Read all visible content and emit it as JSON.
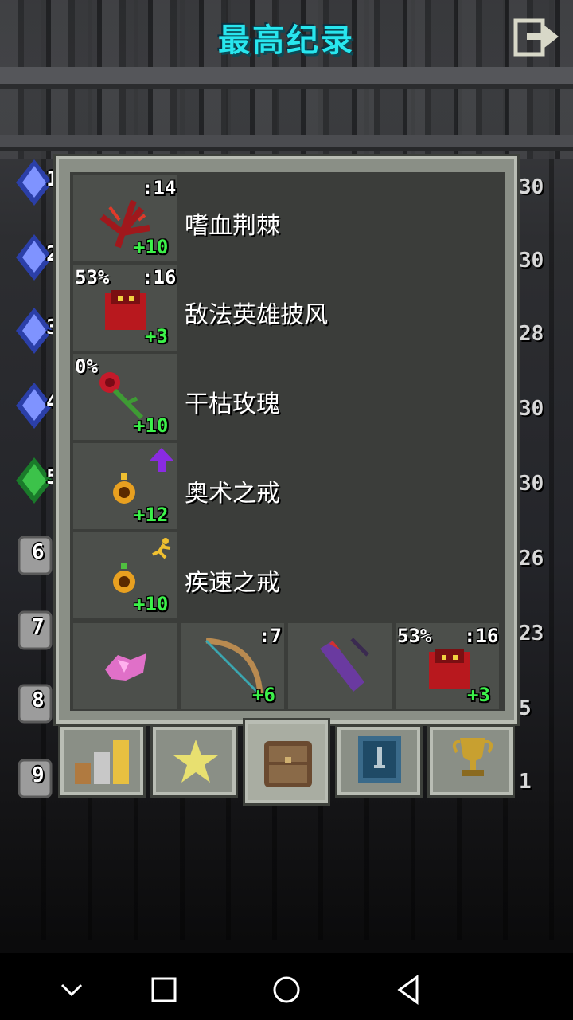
{
  "header": {
    "title": "最高纪录",
    "exit_icon": "exit-door-icon"
  },
  "ranks": [
    "1",
    "2",
    "3",
    "4",
    "5",
    "6",
    "7",
    "8",
    "9"
  ],
  "right_levels": [
    "30",
    "30",
    "28",
    "30",
    "30",
    "26",
    "23",
    "5",
    "1"
  ],
  "items": [
    {
      "name": "嗜血荆棘",
      "qty": ":14",
      "upgrade": "+10",
      "pct": "",
      "icon": "thorns-icon"
    },
    {
      "name": "敌法英雄披风",
      "qty": ":16",
      "upgrade": "+3",
      "pct": "53%",
      "icon": "cloak-icon"
    },
    {
      "name": "干枯玫瑰",
      "qty": "",
      "upgrade": "+10",
      "pct": "0%",
      "icon": "rose-icon"
    },
    {
      "name": "奥术之戒",
      "qty": "",
      "upgrade": "+12",
      "pct": "",
      "icon": "ring-arcane-icon"
    },
    {
      "name": "疾速之戒",
      "qty": "",
      "upgrade": "+10",
      "pct": "",
      "icon": "ring-haste-icon"
    }
  ],
  "quickslots": [
    {
      "icon": "crystal-icon",
      "qty": "",
      "upgrade": "",
      "pct": ""
    },
    {
      "icon": "bow-icon",
      "qty": ":7",
      "upgrade": "+6",
      "pct": ""
    },
    {
      "icon": "quiver-icon",
      "qty": "",
      "upgrade": "",
      "pct": ""
    },
    {
      "icon": "cloak-icon",
      "qty": ":16",
      "upgrade": "+3",
      "pct": "53%"
    }
  ],
  "tabs": [
    "stats-tab",
    "badges-tab",
    "backpack-tab",
    "journal-tab",
    "trophy-tab"
  ],
  "colors": {
    "title": "#28e6ee",
    "upgrade": "#3cf24a",
    "panel": "#8a8f86",
    "slot": "#4c4f4b"
  }
}
